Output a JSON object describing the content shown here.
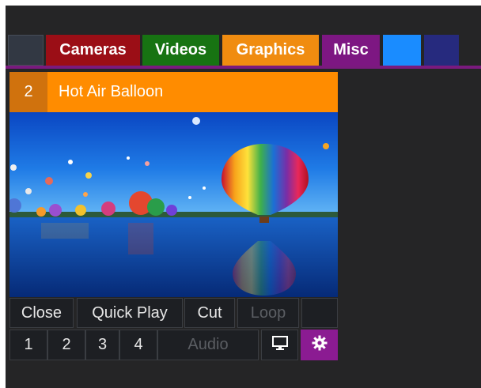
{
  "tabs": {
    "cameras": "Cameras",
    "videos": "Videos",
    "graphics": "Graphics",
    "misc": "Misc"
  },
  "clip": {
    "number": "2",
    "title": "Hot Air Balloon"
  },
  "controls": {
    "close": "Close",
    "quick_play": "Quick Play",
    "cut": "Cut",
    "loop": "Loop",
    "numbers": [
      "1",
      "2",
      "3",
      "4"
    ],
    "audio": "Audio"
  },
  "icons": {
    "monitor": "monitor-icon",
    "settings": "gear-icon"
  },
  "colors": {
    "cameras": "#9b0e16",
    "videos": "#177312",
    "graphics": "#f08c10",
    "misc": "#7d1782",
    "blue_tab": "#1a8cff",
    "navy_tab": "#262a7e",
    "header": "#ff8c00",
    "accent": "#8b1b92"
  }
}
